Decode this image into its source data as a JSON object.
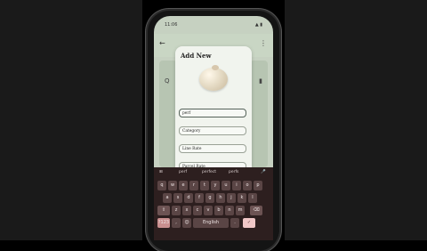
{
  "status_bar": {
    "time": "11:06",
    "icons": "▲ ▮"
  },
  "bg": {
    "back_icon": "←",
    "more_icon": "⋮",
    "left_icon": "Q",
    "right_icon": "▮"
  },
  "modal": {
    "title": "Add New",
    "fields": [
      {
        "value": "perf"
      },
      {
        "value": "Category"
      },
      {
        "value": "Line Rate"
      },
      {
        "value": "Parcel Rate"
      }
    ]
  },
  "keyboard": {
    "suggestions": [
      "perf",
      "perfect",
      "perfs"
    ],
    "emoji_labels": [
      "⊞",
      "🎤"
    ],
    "space_label": "English",
    "keys_row1": [
      "q",
      "w",
      "e",
      "r",
      "t",
      "y",
      "u",
      "i",
      "o",
      "p"
    ],
    "keys_row2": [
      "a",
      "s",
      "d",
      "f",
      "g",
      "h",
      "j",
      "k",
      "l"
    ],
    "keys_row3": [
      "⇧",
      "z",
      "x",
      "c",
      "v",
      "b",
      "n",
      "m",
      "⌫"
    ],
    "bottom_row": [
      "?123",
      ",",
      "😊",
      "English",
      ".",
      "✓"
    ]
  }
}
